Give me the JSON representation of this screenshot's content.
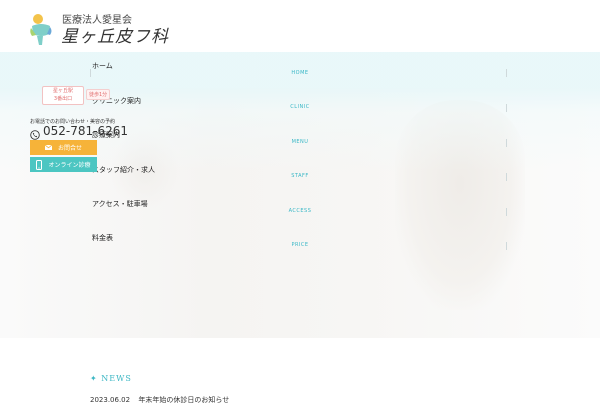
{
  "brand": {
    "corp_name": "医療法人愛星会",
    "clinic_name": "星ヶ丘皮フ科",
    "logo_colors": [
      "#f3c34b",
      "#7fcfc9",
      "#a8d46f",
      "#6aa8d8"
    ]
  },
  "nav": {
    "items": [
      {
        "label": "HOME"
      },
      {
        "label": "CLINIC"
      },
      {
        "label": "MENU"
      },
      {
        "label": "STAFF"
      },
      {
        "label": "ACCESS"
      },
      {
        "label": "PRICE"
      }
    ]
  },
  "sidenav": {
    "items": [
      {
        "label": "ホーム"
      },
      {
        "label": "クリニック案内"
      },
      {
        "label": "診療案内"
      },
      {
        "label": "スタッフ紹介・求人"
      },
      {
        "label": "アクセス・駐車場"
      },
      {
        "label": "料金表"
      }
    ]
  },
  "station": {
    "line1": "星ヶ丘駅",
    "line2": "3番出口",
    "walk": "徒歩1分"
  },
  "contact": {
    "caption": "お電話でのお問い合わせ・美容の予約",
    "phone": "052-781-6261",
    "contact_button": "お問合せ",
    "online_button": "オンライン診療"
  },
  "news": {
    "title": "NEWS",
    "items": [
      {
        "date": "2023.06.02",
        "text": "年末年始の休診日のお知らせ"
      }
    ]
  },
  "colors": {
    "accent": "#38b7c6",
    "contact_btn": "#f6b339",
    "online_btn": "#4cc6c2",
    "nav_bg": "#e8f7f9"
  }
}
